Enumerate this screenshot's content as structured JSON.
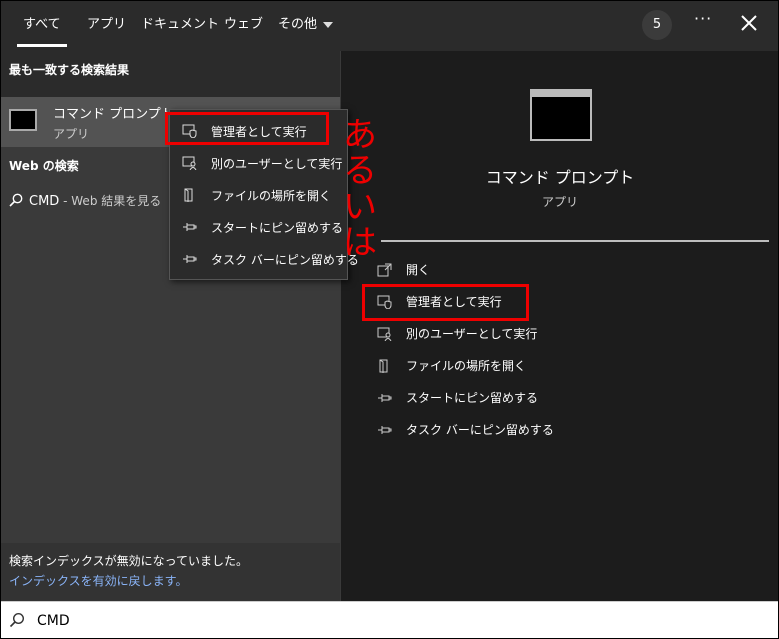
{
  "tabs": [
    {
      "label": "すべて",
      "active": true
    },
    {
      "label": "アプリ"
    },
    {
      "label": "ドキュメント"
    },
    {
      "label": "ウェブ"
    },
    {
      "label": "その他"
    }
  ],
  "header": {
    "badge_count": "5",
    "more": "···"
  },
  "left": {
    "best_match_heading": "最も一致する検索結果",
    "best_match": {
      "name": "コマンド プロンプト",
      "type": "アプリ"
    },
    "web_heading": "Web の検索",
    "web_result": {
      "query": "CMD",
      "suffix": " - Web 結果を見る"
    },
    "notice": {
      "line1": "検索インデックスが無効になっていました。",
      "link": "インデックスを有効に戻します。"
    }
  },
  "context_menu": {
    "items": [
      {
        "label": "管理者として実行",
        "icon": "shield-icon"
      },
      {
        "label": "別のユーザーとして実行",
        "icon": "user-icon"
      },
      {
        "label": "ファイルの場所を開く",
        "icon": "folder-icon"
      },
      {
        "label": "スタートにピン留めする",
        "icon": "pin-icon"
      },
      {
        "label": "タスク バーにピン留めする",
        "icon": "pin-icon"
      }
    ]
  },
  "right": {
    "title": "コマンド プロンプト",
    "subtitle": "アプリ",
    "actions": [
      {
        "label": "開く",
        "icon": "open-icon"
      },
      {
        "label": "管理者として実行",
        "icon": "shield-icon"
      },
      {
        "label": "別のユーザーとして実行",
        "icon": "user-icon"
      },
      {
        "label": "ファイルの場所を開く",
        "icon": "folder-icon"
      },
      {
        "label": "スタートにピン留めする",
        "icon": "pin-icon"
      },
      {
        "label": "タスク バーにピン留めする",
        "icon": "pin-icon"
      }
    ]
  },
  "annotation": {
    "chars": [
      "あ",
      "る",
      "い",
      "は"
    ],
    "color": "#e00000"
  },
  "search": {
    "value": "CMD"
  },
  "colors": {
    "accent_link": "#8ab4f8",
    "highlight": "#535353"
  }
}
